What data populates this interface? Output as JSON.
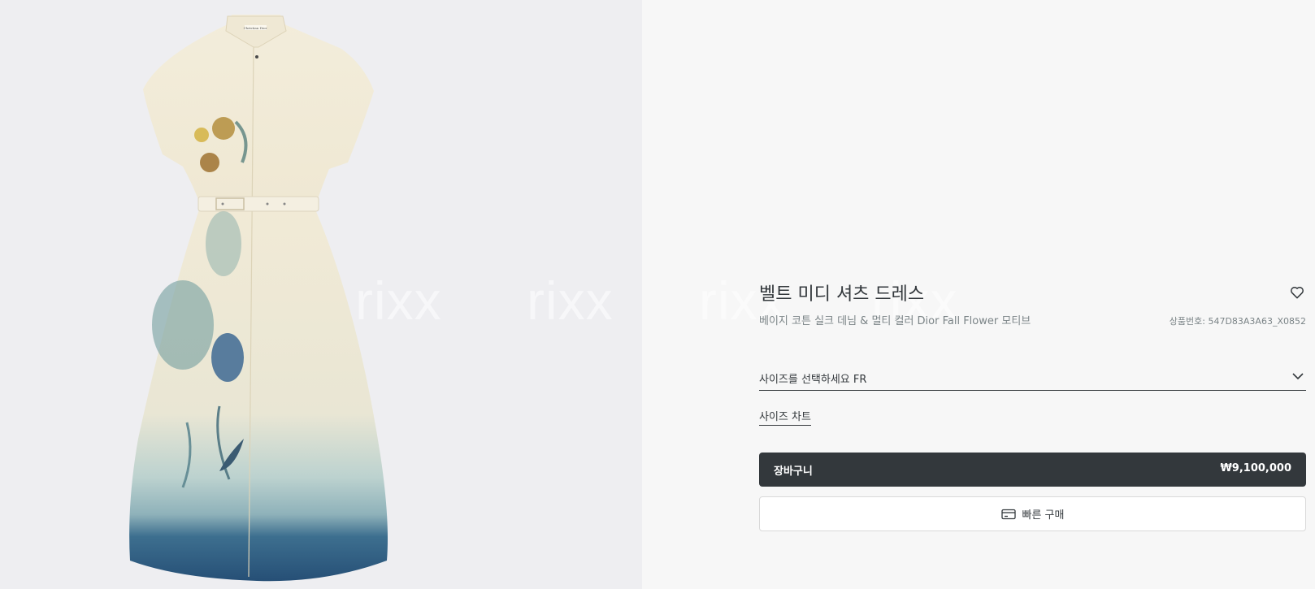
{
  "product": {
    "title": "벨트 미디 셔츠 드레스",
    "subtitle": "베이지 코튼 실크 데님 & 멀티 컬러 Dior Fall Flower 모티브",
    "sku": "상품번호: 547D83A3A63_X0852",
    "size_select": "사이즈를 선택하세요 FR",
    "size_chart": "사이즈 차트",
    "cart_label": "장바구니",
    "price": "₩9,100,000",
    "quick_buy": "빠른 구매",
    "label_text": "Christian Dior"
  },
  "watermark": [
    "rixx",
    "rixx",
    "rixx",
    "rixx"
  ],
  "icons": {
    "wishlist": "heart-icon",
    "dropdown": "chevron-down-icon",
    "quick_buy": "credit-card-icon"
  },
  "colors": {
    "cart_button": "#33383c",
    "info_bg": "#f7f7f7",
    "image_bg": "#eeeef1",
    "dress_cream": "#f1ead6",
    "dress_blue": "#2d5d84"
  }
}
